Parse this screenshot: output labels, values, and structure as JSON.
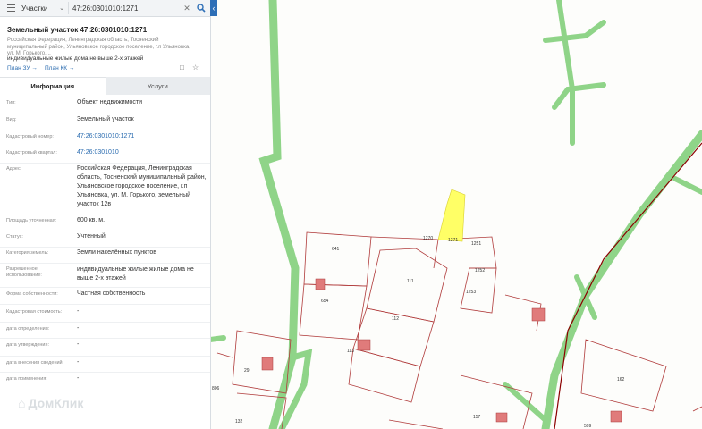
{
  "header": {
    "layer_select": "Участки",
    "search_value": "47:26:0301010:1271"
  },
  "parcel": {
    "title": "Земельный участок 47:26:0301010:1271",
    "address": "Российская Федерация, Ленинградская область, Тосненский муниципальный район, Ульяновское городское поселение, г.п Ульяновка, ул. М. Горького,...",
    "usage": "индивидуальные жилые дома не выше 2-х этажей",
    "plan_zu": "План ЗУ →",
    "plan_kk": "План КК →"
  },
  "tabs": [
    "Информация",
    "Услуги"
  ],
  "fields": [
    {
      "label": "Тип:",
      "value": "Объект недвижимости",
      "link": false
    },
    {
      "label": "Вид:",
      "value": "Земельный участок",
      "link": false
    },
    {
      "label": "Кадастровый номер:",
      "value": "47:26:0301010:1271",
      "link": true
    },
    {
      "label": "Кадастровый квартал:",
      "value": "47:26:0301010",
      "link": true
    },
    {
      "label": "Адрес:",
      "value": "Российская Федерация, Ленинградская область, Тосненский муниципальный район, Ульяновское городское поселение, г.п Ульяновка, ул. М. Горького, земельный участок 12в",
      "link": false
    },
    {
      "label": "Площадь уточненная:",
      "value": "600 кв. м.",
      "link": false
    },
    {
      "label": "Статус:",
      "value": "Учтенный",
      "link": false
    },
    {
      "label": "Категория земель:",
      "value": "Земли населённых пунктов",
      "link": false
    },
    {
      "label": "Разрешенное использование:",
      "value": "индивидуальные жилые жилые дома не выше 2-х этажей",
      "link": false
    },
    {
      "label": "Форма собственности:",
      "value": "Частная собственность",
      "link": false
    },
    {
      "label": "Кадастровая стоимость:",
      "value": "-",
      "link": false
    },
    {
      "label": "дата определения:",
      "value": "-",
      "link": false
    },
    {
      "label": "дата утверждения:",
      "value": "-",
      "link": false
    },
    {
      "label": "дата внесения сведений:",
      "value": "-",
      "link": false
    },
    {
      "label": "дата применения:",
      "value": "-",
      "link": false
    }
  ],
  "watermark": "ДомКлик",
  "map": {
    "labels": [
      "641",
      "1270",
      "1271",
      "1251",
      "1252",
      "111",
      "1253",
      "654",
      "112",
      "113",
      "29",
      "162",
      "157",
      "599",
      "132",
      "806"
    ]
  },
  "colors": {
    "accent": "#2e6fb7",
    "link": "#2b6cb0",
    "parcel_line": "#a52a2a",
    "road_green": "#7fcf78",
    "selected_parcel": "#ffff66"
  },
  "icons": [
    "menu-icon",
    "chevron-down-icon",
    "close-icon",
    "search-icon",
    "collapse-arrow-icon",
    "map-plan-icon",
    "star-icon"
  ]
}
